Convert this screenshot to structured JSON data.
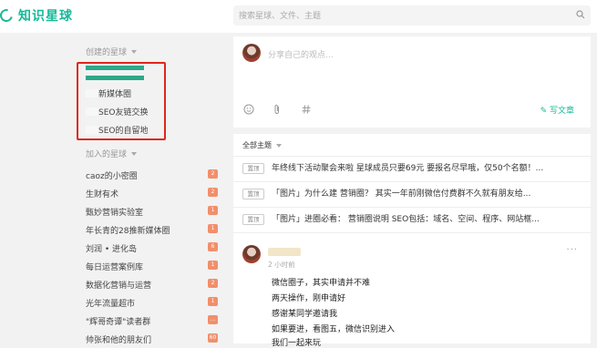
{
  "app": {
    "name": "知识星球"
  },
  "search": {
    "placeholder": "搜索星球、文件、主题"
  },
  "sidebar": {
    "created_title": "创建的星球",
    "created_items": [
      {
        "label": "新媒体圈"
      },
      {
        "label": "SEO友链交换"
      },
      {
        "label": "SEO的自留地"
      }
    ],
    "joined_title": "加入的星球",
    "joined_items": [
      {
        "label": "caoz的小密圈",
        "count": "2"
      },
      {
        "label": "生财有术",
        "count": "2"
      },
      {
        "label": "甄妙营销实验室",
        "count": "1"
      },
      {
        "label": "年长青的28推新媒体圈",
        "count": "1"
      },
      {
        "label": "刘润 • 进化岛",
        "count": "6"
      },
      {
        "label": "每日运营案例库",
        "count": "1"
      },
      {
        "label": "数据化营销与运营",
        "count": "2"
      },
      {
        "label": "光年流量超市",
        "count": "1"
      },
      {
        "label": "\"辉哥奇谭\"读者群",
        "count": "..."
      },
      {
        "label": "帅张和他的朋友们",
        "count": "60"
      }
    ]
  },
  "composer": {
    "placeholder": "分享自己的观点...",
    "write_label": "写文章",
    "icons": [
      "emoji-icon",
      "attachment-icon",
      "hashtag-icon"
    ]
  },
  "feed": {
    "header": "全部主题",
    "topics": [
      {
        "tag": "置顶",
        "text": "年终线下活动聚会来啦 星球成员只要69元 要报名尽早哦，仅50个名额！..."
      },
      {
        "tag": "置顶",
        "text": "「图片」为什么建 营销圈？ 其实一年前刚微信付费群不久就有朋友给..."
      },
      {
        "tag": "置顶",
        "text": "「图片」进圈必看： 营销圈说明 SEO包括：域名、空间、程序、网站框..."
      }
    ],
    "post": {
      "time": "2 小时前",
      "more": "···",
      "lines": [
        "微信圈子，其实申请并不难",
        "两天操作，刚申请好",
        "感谢某同学邀请我",
        "如果要进，看图五，微信识别进入",
        "我们一起来玩"
      ]
    }
  }
}
